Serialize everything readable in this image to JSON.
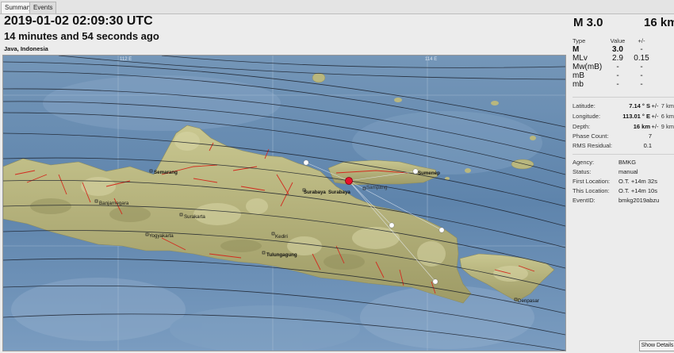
{
  "tabs": [
    "Summary",
    "Events"
  ],
  "header": {
    "time": "2019-01-02 02:09:30 UTC",
    "ago": "14 minutes and 54 seconds ago",
    "region": "Java, Indonesia",
    "magnitude": "M 3.0",
    "depth": "16 km"
  },
  "magnitudes": {
    "headers": [
      "Type",
      "Value",
      "+/-"
    ],
    "rows": [
      {
        "type": "M",
        "value": "3.0",
        "unc": "-"
      },
      {
        "type": "MLv",
        "value": "2.9",
        "unc": "0.15"
      },
      {
        "type": "Mw(mB)",
        "value": "-",
        "unc": "-"
      },
      {
        "type": "mB",
        "value": "-",
        "unc": "-"
      },
      {
        "type": "mb",
        "value": "-",
        "unc": "-"
      }
    ]
  },
  "origin": {
    "latitude": {
      "label": "Latitude:",
      "value": "7.14",
      "dir": "° S",
      "pm": "+/-",
      "unc": "7 km"
    },
    "longitude": {
      "label": "Longitude:",
      "value": "113.01",
      "dir": "° E",
      "pm": "+/-",
      "unc": "6 km"
    },
    "depth": {
      "label": "Depth:",
      "value": "16",
      "unit": "km",
      "pm": "+/-",
      "unc": "9 km"
    },
    "phase_count": {
      "label": "Phase Count:",
      "value": "7"
    },
    "rms": {
      "label": "RMS Residual:",
      "value": "0.1"
    }
  },
  "info": {
    "agency": {
      "label": "Agency:",
      "value": "BMKG"
    },
    "status": {
      "label": "Status:",
      "value": "manual"
    },
    "first_location": {
      "label": "First Location:",
      "value": "O.T. +14m 32s"
    },
    "this_location": {
      "label": "This Location:",
      "value": "O.T. +14m 10s"
    },
    "event_id": {
      "label": "EventID:",
      "value": "bmkg2019abzu"
    }
  },
  "map": {
    "grid_labels": [
      "112 E",
      "114 E"
    ],
    "places": [
      {
        "name": "Semarang"
      },
      {
        "name": "Banjarnegara"
      },
      {
        "name": "Surakarta"
      },
      {
        "name": "Yogyakarta"
      },
      {
        "name": "Kediri"
      },
      {
        "name": "Tulungagung"
      },
      {
        "name": "Surabaya"
      },
      {
        "name": "Surabaya"
      },
      {
        "name": "Sampang"
      },
      {
        "name": "Sumenep"
      },
      {
        "name": "Denpasar"
      }
    ],
    "colors": {
      "sea": "#5f86ae",
      "land": "#b9b77e",
      "epicenter": "#e8102a",
      "station": "#ffffff"
    }
  },
  "show_details": "Show Details"
}
